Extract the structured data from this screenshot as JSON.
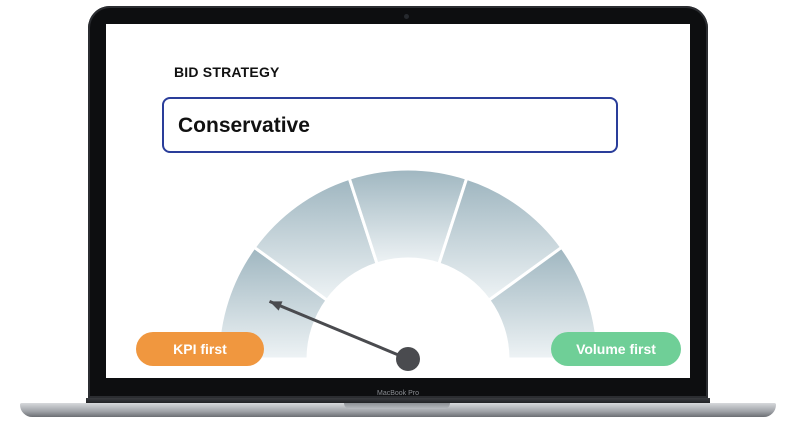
{
  "bid_strategy": {
    "label": "BID STRATEGY",
    "value": "Conservative"
  },
  "gauge": {
    "segments": 5,
    "left_label": "KPI first",
    "right_label": "Volume first",
    "needle_segment": 1
  },
  "device": {
    "brand": "MacBook Pro"
  },
  "colors": {
    "kpi_pill": "#f0973f",
    "volume_pill": "#6fcf97",
    "field_border": "#2a3d9a",
    "gauge_top": "#9fb6c0",
    "gauge_bottom": "#eef3f5",
    "needle": "#4a4b4f"
  }
}
